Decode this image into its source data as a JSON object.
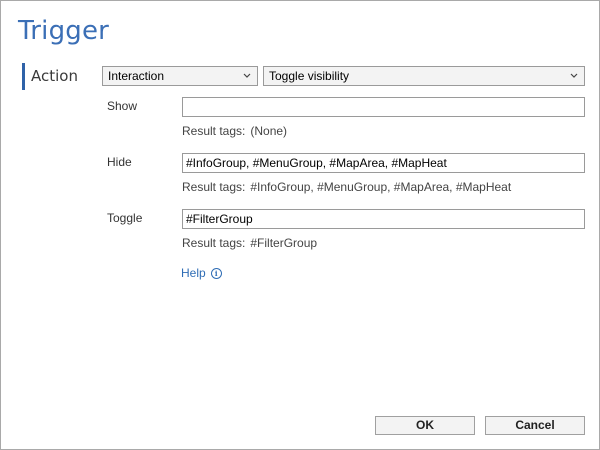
{
  "dialog": {
    "title": "Trigger"
  },
  "action": {
    "label": "Action",
    "type_select": "Interaction",
    "behavior_select": "Toggle visibility"
  },
  "rows": {
    "show": {
      "label": "Show",
      "value": "",
      "result_label": "Result tags:",
      "result_value": "(None)"
    },
    "hide": {
      "label": "Hide",
      "value": "#InfoGroup, #MenuGroup, #MapArea, #MapHeat",
      "result_label": "Result tags:",
      "result_value": "#InfoGroup, #MenuGroup, #MapArea, #MapHeat"
    },
    "toggle": {
      "label": "Toggle",
      "value": "#FilterGroup",
      "result_label": "Result tags:",
      "result_value": "#FilterGroup"
    }
  },
  "help": {
    "label": "Help",
    "icon": "info-icon"
  },
  "buttons": {
    "ok": "OK",
    "cancel": "Cancel"
  },
  "colors": {
    "accent": "#3b6fb6",
    "link": "#2f6db5"
  }
}
